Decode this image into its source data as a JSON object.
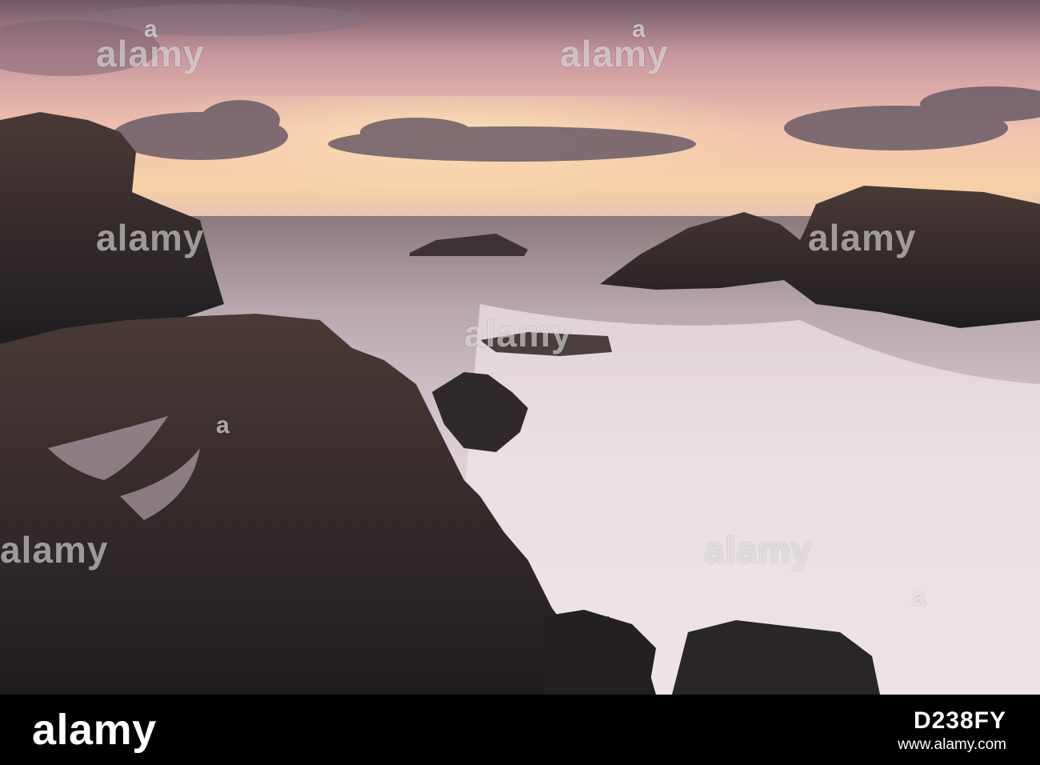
{
  "watermark": {
    "text": "alamy",
    "short": "a"
  },
  "footer": {
    "logo": "alamy",
    "url": "www.alamy.com",
    "image_code": "D238FY"
  },
  "colors": {
    "sky_top": "#6e5560",
    "sky_glow": "#f5c6a8",
    "sea": "#cbb9c4",
    "rock": "#3a2f2e",
    "footer_bg": "#000000"
  }
}
